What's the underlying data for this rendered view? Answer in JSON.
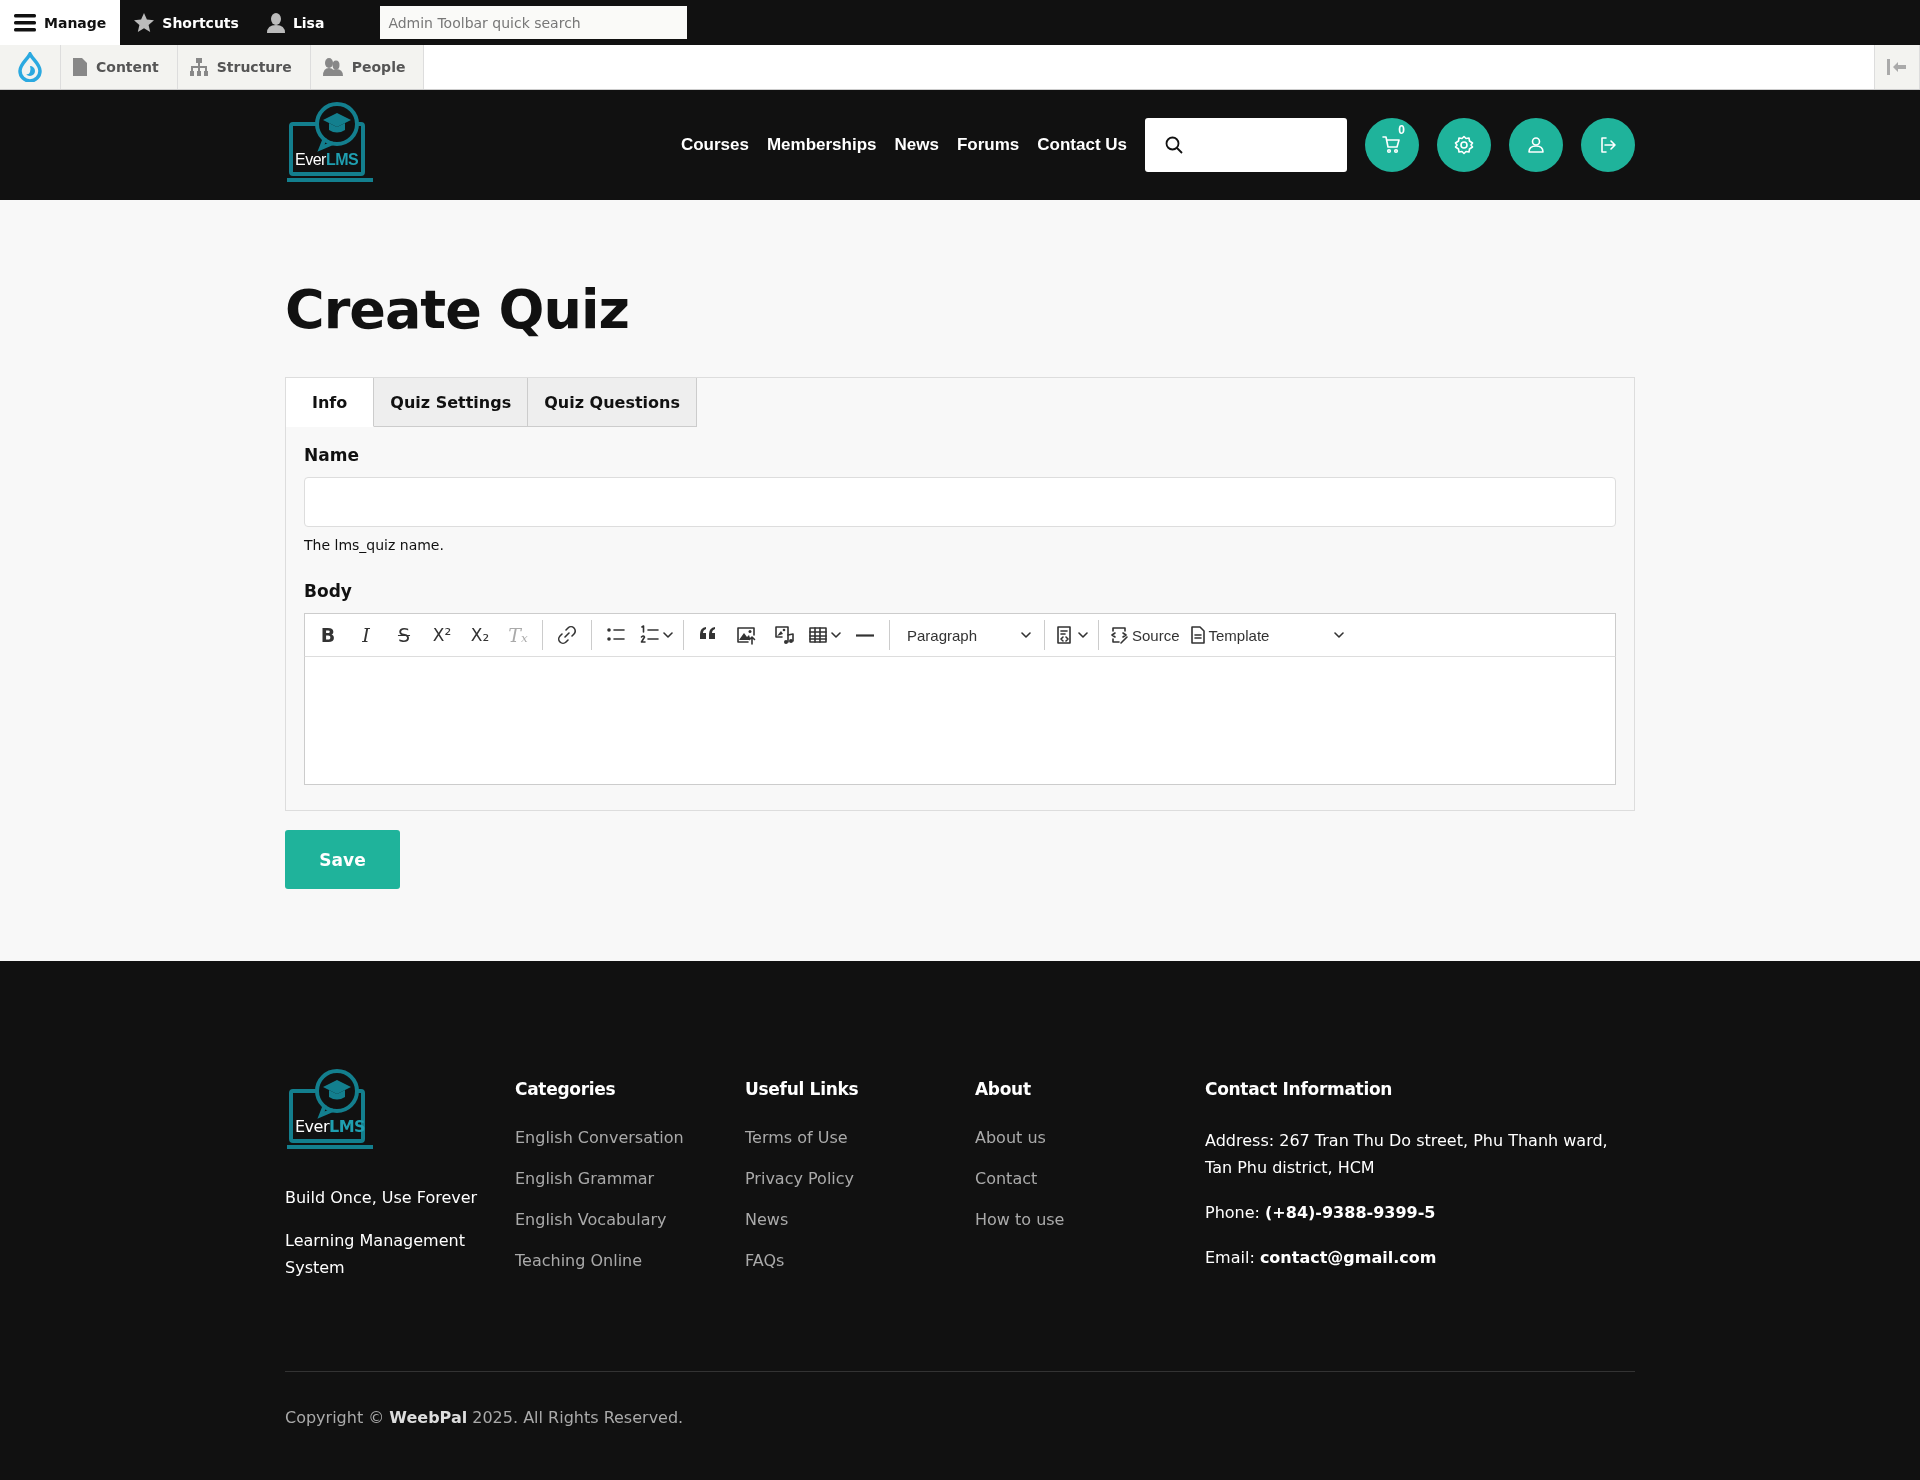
{
  "admin_toolbar": {
    "items": [
      {
        "kind": "menu",
        "label": "Manage",
        "selected": true
      },
      {
        "kind": "star",
        "label": "Shortcuts",
        "selected": false
      },
      {
        "kind": "user",
        "label": "Lisa",
        "selected": false
      }
    ],
    "search": {
      "placeholder": "Admin Toolbar quick search"
    }
  },
  "admin_tray": {
    "items": [
      {
        "kind": "content",
        "label": "Content"
      },
      {
        "kind": "structure",
        "label": "Structure"
      },
      {
        "kind": "people",
        "label": "People"
      }
    ]
  },
  "header": {
    "logo": {
      "text": "Ever**LMS**"
    },
    "nav": [
      "Courses",
      "Memberships",
      "News",
      "Forums",
      "Contact Us"
    ],
    "actions": [
      {
        "kind": "cart",
        "badge": "0"
      },
      {
        "kind": "settings"
      },
      {
        "kind": "account"
      },
      {
        "kind": "logout"
      }
    ]
  },
  "page_title": "Create Quiz",
  "tabs": [
    {
      "label": "Info",
      "selected": true
    },
    {
      "label": "Quiz Settings",
      "selected": false
    },
    {
      "label": "Quiz Questions",
      "selected": false
    }
  ],
  "name_field": {
    "label": "Name",
    "help": "The lms_quiz name."
  },
  "body_field": {
    "label": "Body",
    "toolbar": [
      {
        "kind": "bold",
        "glyph": "B",
        "disabled": false
      },
      {
        "kind": "italic",
        "glyph": "I",
        "disabled": false
      },
      {
        "kind": "strike",
        "glyph": "S",
        "disabled": false
      },
      {
        "kind": "superscript",
        "glyph": "X²",
        "disabled": false
      },
      {
        "kind": "subscript",
        "glyph": "X₂",
        "disabled": false
      },
      {
        "kind": "clear",
        "glyph": "Tₓ",
        "disabled": true
      },
      {
        "kind": "separator"
      },
      {
        "kind": "link"
      },
      {
        "kind": "separator"
      },
      {
        "kind": "bullets"
      },
      {
        "kind": "numbers"
      },
      {
        "kind": "separator"
      },
      {
        "kind": "quote"
      },
      {
        "kind": "image"
      },
      {
        "kind": "media"
      },
      {
        "kind": "table"
      },
      {
        "kind": "rule"
      },
      {
        "kind": "separator"
      },
      {
        "kind": "select",
        "label": "Paragraph"
      },
      {
        "kind": "separator"
      },
      {
        "kind": "codeblock"
      },
      {
        "kind": "separator"
      },
      {
        "kind": "source",
        "label": "Source"
      },
      {
        "kind": "template",
        "label": "Template"
      }
    ]
  },
  "save_button": "Save",
  "footer": {
    "logo": {
      "text": "Ever**LMS**"
    },
    "taglines": [
      "Build Once, Use Forever",
      "Learning Management System"
    ],
    "columns": [
      {
        "heading": "Categories",
        "links": [
          "English Conversation",
          "English Grammar",
          "English Vocabulary",
          "Teaching Online"
        ]
      },
      {
        "heading": "Useful Links",
        "links": [
          "Terms of Use",
          "Privacy Policy",
          "News",
          "FAQs"
        ]
      },
      {
        "heading": "About",
        "links": [
          "About us",
          "Contact",
          "How to use"
        ]
      }
    ],
    "contact": {
      "heading": "Contact Information",
      "lines": [
        "Address: 267 Tran Thu Do street, Phu Thanh ward, Tan Phu district, HCM",
        "Phone: **(+84)-9388-9399-5**",
        "Email: **contact@gmail.com**"
      ]
    },
    "copyright": "Copyright © **WeebPal** 2025. All Rights Reserved."
  }
}
